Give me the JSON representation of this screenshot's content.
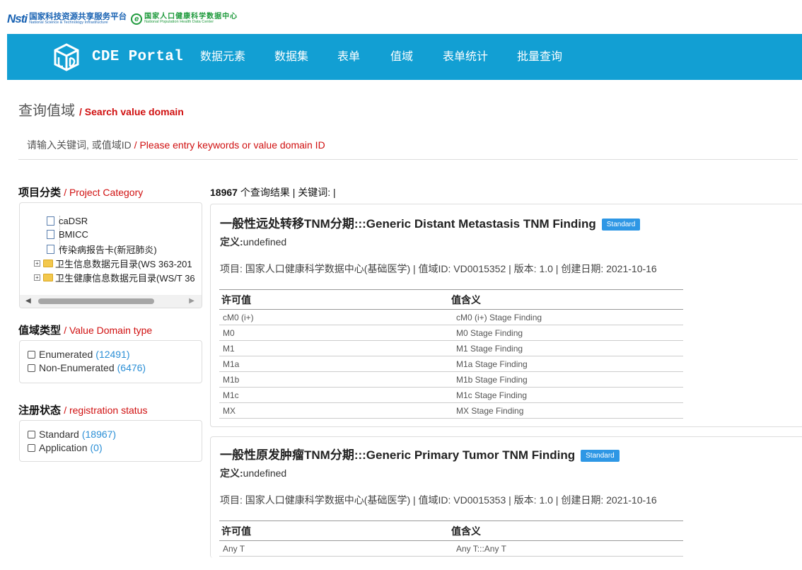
{
  "header": {
    "nsti_mark": "Nsti",
    "org_cn": "国家科技资源共享服务平台",
    "org_en": "National Science & Technology Infrastructure",
    "e_mark": "e",
    "org2_cn": "国家人口健康科学数据中心",
    "org2_en": "National Population Health Data Center"
  },
  "nav": {
    "brand": "CDE Portal",
    "items": [
      "数据元素",
      "数据集",
      "表单",
      "值域",
      "表单统计",
      "批量查询"
    ]
  },
  "page": {
    "title": "查询值域",
    "title_en": "/ Search value domain",
    "search_hint": "请输入关键词, 或值域ID",
    "search_hint_en": "/ Please entry keywords or value domain ID"
  },
  "sidebar": {
    "category_title": "项目分类",
    "category_title_en": "/ Project Category",
    "tree": [
      {
        "label": "caDSR",
        "type": "file"
      },
      {
        "label": "BMICC",
        "type": "file"
      },
      {
        "label": "传染病报告卡(新冠肺炎)",
        "type": "file"
      },
      {
        "label": "卫生信息数据元目录(WS 363-201",
        "type": "folder"
      },
      {
        "label": "卫生健康信息数据元目录(WS/T 36",
        "type": "folder"
      }
    ],
    "domain_type_title": "值域类型",
    "domain_type_title_en": "/ Value Domain type",
    "domain_types": [
      {
        "label": "Enumerated",
        "count": "(12491)"
      },
      {
        "label": "Non-Enumerated",
        "count": "(6476)"
      }
    ],
    "status_title": "注册状态",
    "status_title_en": "/ registration status",
    "statuses": [
      {
        "label": "Standard",
        "count": "(18967)"
      },
      {
        "label": "Application",
        "count": "(0)"
      }
    ]
  },
  "results": {
    "count": "18967",
    "count_suffix": "个查询结果 | 关键词: |",
    "cards": [
      {
        "title": "一般性远处转移TNM分期:::Generic Distant Metastasis TNM Finding",
        "badge": "Standard",
        "def_label": "定义:",
        "def_value": "undefined",
        "meta": "项目: 国家人口健康科学数据中心(基础医学) | 值域ID: VD0015352 | 版本: 1.0 | 创建日期: 2021-10-16",
        "col1": "许可值",
        "col2": "值含义",
        "rows": [
          [
            "cM0 (i+)",
            "cM0 (i+) Stage Finding"
          ],
          [
            "M0",
            "M0 Stage Finding"
          ],
          [
            "M1",
            "M1 Stage Finding"
          ],
          [
            "M1a",
            "M1a Stage Finding"
          ],
          [
            "M1b",
            "M1b Stage Finding"
          ],
          [
            "M1c",
            "M1c Stage Finding"
          ],
          [
            "MX",
            "MX Stage Finding"
          ]
        ]
      },
      {
        "title": "一般性原发肿瘤TNM分期:::Generic Primary Tumor TNM Finding",
        "badge": "Standard",
        "def_label": "定义:",
        "def_value": "undefined",
        "meta": "项目: 国家人口健康科学数据中心(基础医学) | 值域ID: VD0015353 | 版本: 1.0 | 创建日期: 2021-10-16",
        "col1": "许可值",
        "col2": "值含义",
        "rows": [
          [
            "Any T",
            "Any T:::Any T"
          ]
        ]
      }
    ]
  }
}
